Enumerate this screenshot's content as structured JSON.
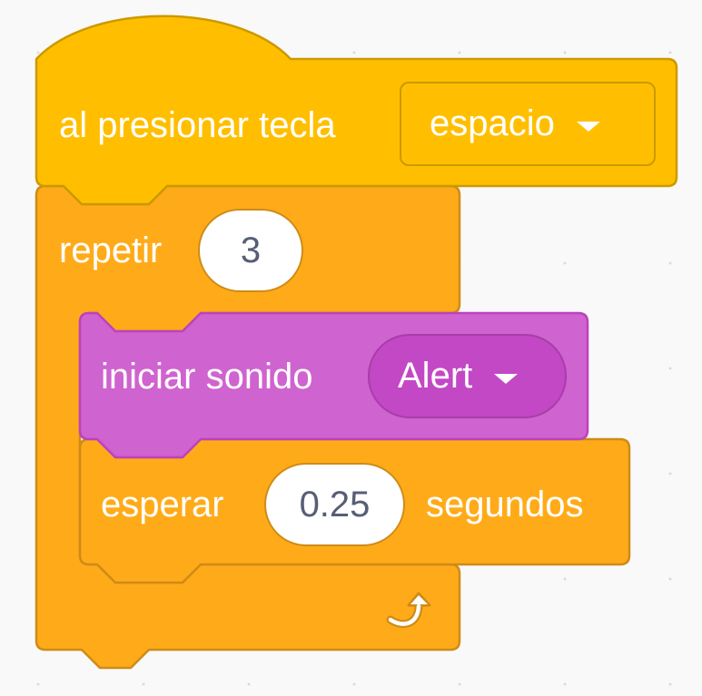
{
  "event_block": {
    "label": "al presionar tecla",
    "key_dropdown": {
      "selected": "espacio"
    },
    "color": "#ffbf00",
    "border_color": "#cc9900"
  },
  "repeat_block": {
    "label": "repetir",
    "times": "3",
    "color": "#ffab19",
    "border_color": "#cf8b17",
    "loop_icon": "loop-arrow-icon"
  },
  "sound_block": {
    "label": "iniciar sonido",
    "sound_dropdown": {
      "selected": "Alert"
    },
    "color": "#cf63cf",
    "border_color": "#bd42bd"
  },
  "wait_block": {
    "label_before": "esperar",
    "seconds": "0.25",
    "label_after": "segundos",
    "color": "#ffab19",
    "border_color": "#cf8b17"
  }
}
